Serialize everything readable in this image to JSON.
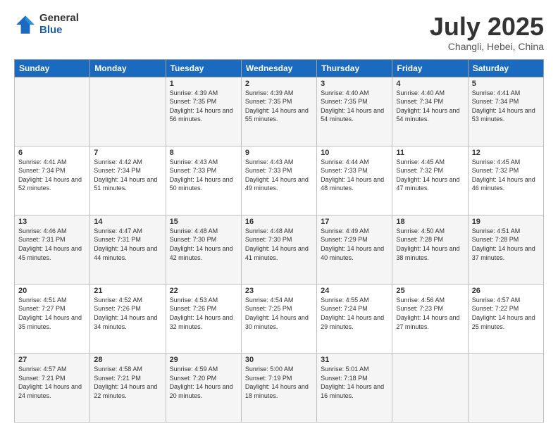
{
  "header": {
    "logo": {
      "general": "General",
      "blue": "Blue"
    },
    "title": "July 2025",
    "location": "Changli, Hebei, China"
  },
  "weekdays": [
    "Sunday",
    "Monday",
    "Tuesday",
    "Wednesday",
    "Thursday",
    "Friday",
    "Saturday"
  ],
  "weeks": [
    [
      {
        "day": "",
        "info": ""
      },
      {
        "day": "",
        "info": ""
      },
      {
        "day": "1",
        "info": "Sunrise: 4:39 AM\nSunset: 7:35 PM\nDaylight: 14 hours and 56 minutes."
      },
      {
        "day": "2",
        "info": "Sunrise: 4:39 AM\nSunset: 7:35 PM\nDaylight: 14 hours and 55 minutes."
      },
      {
        "day": "3",
        "info": "Sunrise: 4:40 AM\nSunset: 7:35 PM\nDaylight: 14 hours and 54 minutes."
      },
      {
        "day": "4",
        "info": "Sunrise: 4:40 AM\nSunset: 7:34 PM\nDaylight: 14 hours and 54 minutes."
      },
      {
        "day": "5",
        "info": "Sunrise: 4:41 AM\nSunset: 7:34 PM\nDaylight: 14 hours and 53 minutes."
      }
    ],
    [
      {
        "day": "6",
        "info": "Sunrise: 4:41 AM\nSunset: 7:34 PM\nDaylight: 14 hours and 52 minutes."
      },
      {
        "day": "7",
        "info": "Sunrise: 4:42 AM\nSunset: 7:34 PM\nDaylight: 14 hours and 51 minutes."
      },
      {
        "day": "8",
        "info": "Sunrise: 4:43 AM\nSunset: 7:33 PM\nDaylight: 14 hours and 50 minutes."
      },
      {
        "day": "9",
        "info": "Sunrise: 4:43 AM\nSunset: 7:33 PM\nDaylight: 14 hours and 49 minutes."
      },
      {
        "day": "10",
        "info": "Sunrise: 4:44 AM\nSunset: 7:33 PM\nDaylight: 14 hours and 48 minutes."
      },
      {
        "day": "11",
        "info": "Sunrise: 4:45 AM\nSunset: 7:32 PM\nDaylight: 14 hours and 47 minutes."
      },
      {
        "day": "12",
        "info": "Sunrise: 4:45 AM\nSunset: 7:32 PM\nDaylight: 14 hours and 46 minutes."
      }
    ],
    [
      {
        "day": "13",
        "info": "Sunrise: 4:46 AM\nSunset: 7:31 PM\nDaylight: 14 hours and 45 minutes."
      },
      {
        "day": "14",
        "info": "Sunrise: 4:47 AM\nSunset: 7:31 PM\nDaylight: 14 hours and 44 minutes."
      },
      {
        "day": "15",
        "info": "Sunrise: 4:48 AM\nSunset: 7:30 PM\nDaylight: 14 hours and 42 minutes."
      },
      {
        "day": "16",
        "info": "Sunrise: 4:48 AM\nSunset: 7:30 PM\nDaylight: 14 hours and 41 minutes."
      },
      {
        "day": "17",
        "info": "Sunrise: 4:49 AM\nSunset: 7:29 PM\nDaylight: 14 hours and 40 minutes."
      },
      {
        "day": "18",
        "info": "Sunrise: 4:50 AM\nSunset: 7:28 PM\nDaylight: 14 hours and 38 minutes."
      },
      {
        "day": "19",
        "info": "Sunrise: 4:51 AM\nSunset: 7:28 PM\nDaylight: 14 hours and 37 minutes."
      }
    ],
    [
      {
        "day": "20",
        "info": "Sunrise: 4:51 AM\nSunset: 7:27 PM\nDaylight: 14 hours and 35 minutes."
      },
      {
        "day": "21",
        "info": "Sunrise: 4:52 AM\nSunset: 7:26 PM\nDaylight: 14 hours and 34 minutes."
      },
      {
        "day": "22",
        "info": "Sunrise: 4:53 AM\nSunset: 7:26 PM\nDaylight: 14 hours and 32 minutes."
      },
      {
        "day": "23",
        "info": "Sunrise: 4:54 AM\nSunset: 7:25 PM\nDaylight: 14 hours and 30 minutes."
      },
      {
        "day": "24",
        "info": "Sunrise: 4:55 AM\nSunset: 7:24 PM\nDaylight: 14 hours and 29 minutes."
      },
      {
        "day": "25",
        "info": "Sunrise: 4:56 AM\nSunset: 7:23 PM\nDaylight: 14 hours and 27 minutes."
      },
      {
        "day": "26",
        "info": "Sunrise: 4:57 AM\nSunset: 7:22 PM\nDaylight: 14 hours and 25 minutes."
      }
    ],
    [
      {
        "day": "27",
        "info": "Sunrise: 4:57 AM\nSunset: 7:21 PM\nDaylight: 14 hours and 24 minutes."
      },
      {
        "day": "28",
        "info": "Sunrise: 4:58 AM\nSunset: 7:21 PM\nDaylight: 14 hours and 22 minutes."
      },
      {
        "day": "29",
        "info": "Sunrise: 4:59 AM\nSunset: 7:20 PM\nDaylight: 14 hours and 20 minutes."
      },
      {
        "day": "30",
        "info": "Sunrise: 5:00 AM\nSunset: 7:19 PM\nDaylight: 14 hours and 18 minutes."
      },
      {
        "day": "31",
        "info": "Sunrise: 5:01 AM\nSunset: 7:18 PM\nDaylight: 14 hours and 16 minutes."
      },
      {
        "day": "",
        "info": ""
      },
      {
        "day": "",
        "info": ""
      }
    ]
  ]
}
